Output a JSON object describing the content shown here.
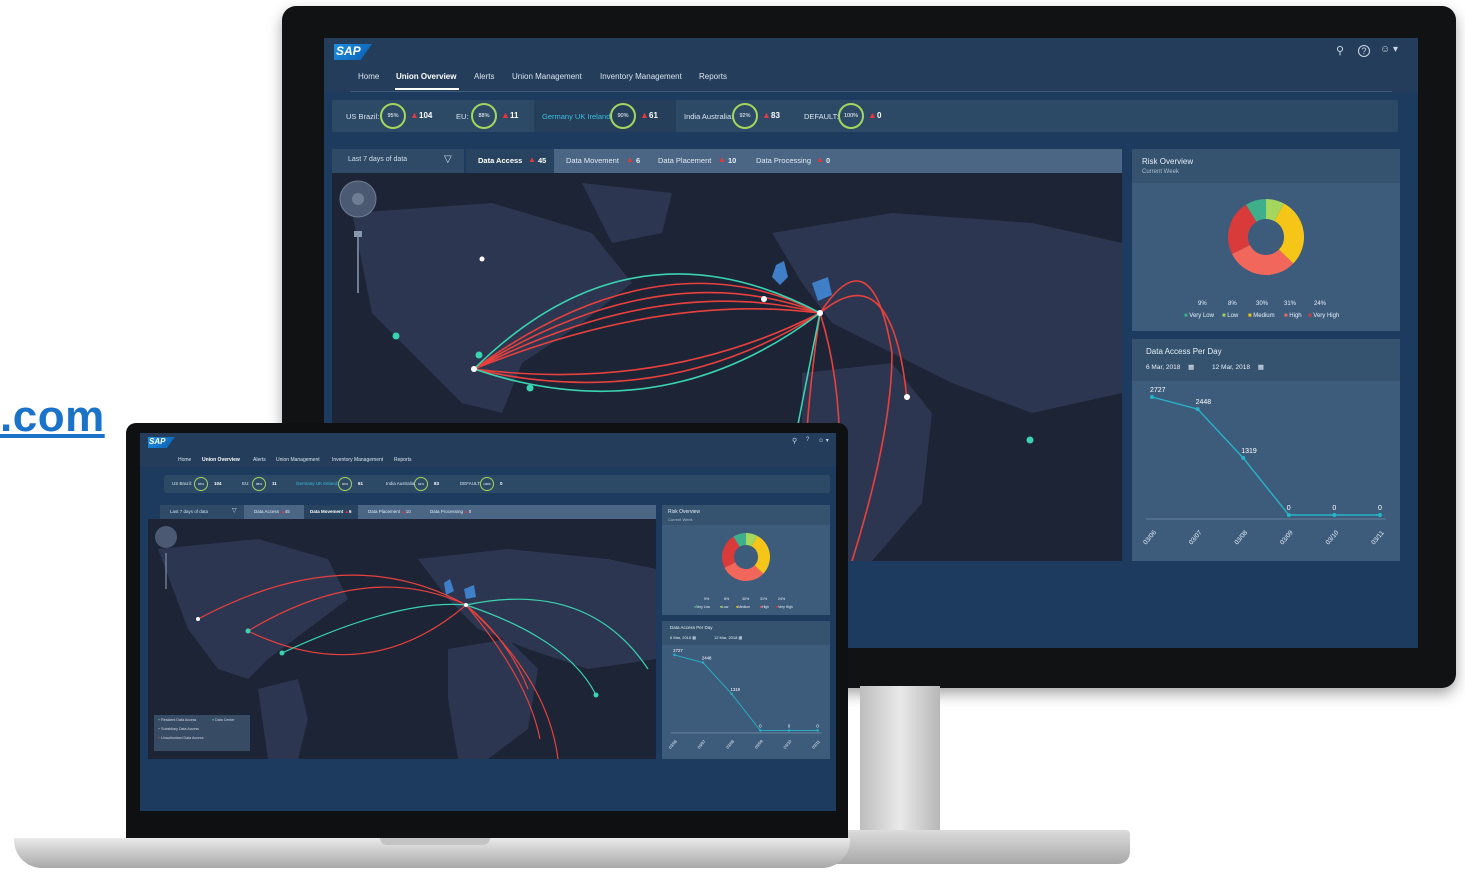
{
  "page": {
    "domain_text": ".com"
  },
  "app": {
    "logo": "SAP"
  },
  "nav": {
    "items": [
      "Home",
      "Union Overview",
      "Alerts",
      "Union Management",
      "Inventory Management",
      "Reports"
    ],
    "active": "Union Overview"
  },
  "shell_icons": {
    "search": "⚲",
    "help": "?",
    "user": "☺ ▾"
  },
  "unions": [
    {
      "label": "US Brazil:",
      "pct": "95%",
      "count": "104"
    },
    {
      "label": "EU:",
      "pct": "88%",
      "count": "11"
    },
    {
      "label": "Germany UK Ireland:",
      "pct": "90%",
      "count": "61"
    },
    {
      "label": "India Australia:",
      "pct": "92%",
      "count": "83"
    },
    {
      "label": "DEFAULT:",
      "pct": "100%",
      "count": "0"
    }
  ],
  "filter": {
    "label": "Last 7 days of data",
    "icon": "filter-icon"
  },
  "tabs": [
    {
      "label": "Data Access",
      "count": "45"
    },
    {
      "label": "Data Movement",
      "count": "6"
    },
    {
      "label": "Data Placement",
      "count": "10"
    },
    {
      "label": "Data Processing",
      "count": "0"
    }
  ],
  "laptop_tabs": [
    {
      "label": "Data Access",
      "count": "45"
    },
    {
      "label": "Data Movement",
      "count": "6"
    },
    {
      "label": "Data Placement",
      "count": "10"
    },
    {
      "label": "Data Processing",
      "count": "0"
    }
  ],
  "risk": {
    "title": "Risk Overview",
    "subtitle": "Current Week",
    "percents": [
      "9%",
      "8%",
      "30%",
      "31%",
      "24%"
    ],
    "legend": [
      "Very Low",
      "Low",
      "Medium",
      "High",
      "Very High"
    ],
    "colors": [
      "#3fae8a",
      "#a4d65e",
      "#f5c518",
      "#f2675c",
      "#d93a3a"
    ]
  },
  "access": {
    "title": "Data Access Per Day",
    "from": "6 Mar, 2018",
    "to": "12 Mar, 2018"
  },
  "map_legend": [
    "Resident Data Access",
    "Subsidiary Data Access",
    "Unauthorized Data Access",
    "Data Center"
  ],
  "chart_data": [
    {
      "type": "pie",
      "title": "Risk Overview",
      "categories": [
        "Very Low",
        "Low",
        "Medium",
        "High",
        "Very High"
      ],
      "values": [
        9,
        8,
        30,
        31,
        24
      ]
    },
    {
      "type": "line",
      "title": "Data Access Per Day",
      "x": [
        "03/06",
        "03/07",
        "03/08",
        "03/09",
        "03/10",
        "03/11"
      ],
      "series": [
        {
          "values": [
            2727,
            2448,
            1319,
            0,
            0,
            0
          ]
        }
      ]
    }
  ],
  "colors": {
    "shell": "#233d5b",
    "ring": "#a4d65e",
    "alert": "#e5383b",
    "arc_red": "#e8413d",
    "arc_teal": "#3ad3b0",
    "line": "#27b4c8"
  }
}
